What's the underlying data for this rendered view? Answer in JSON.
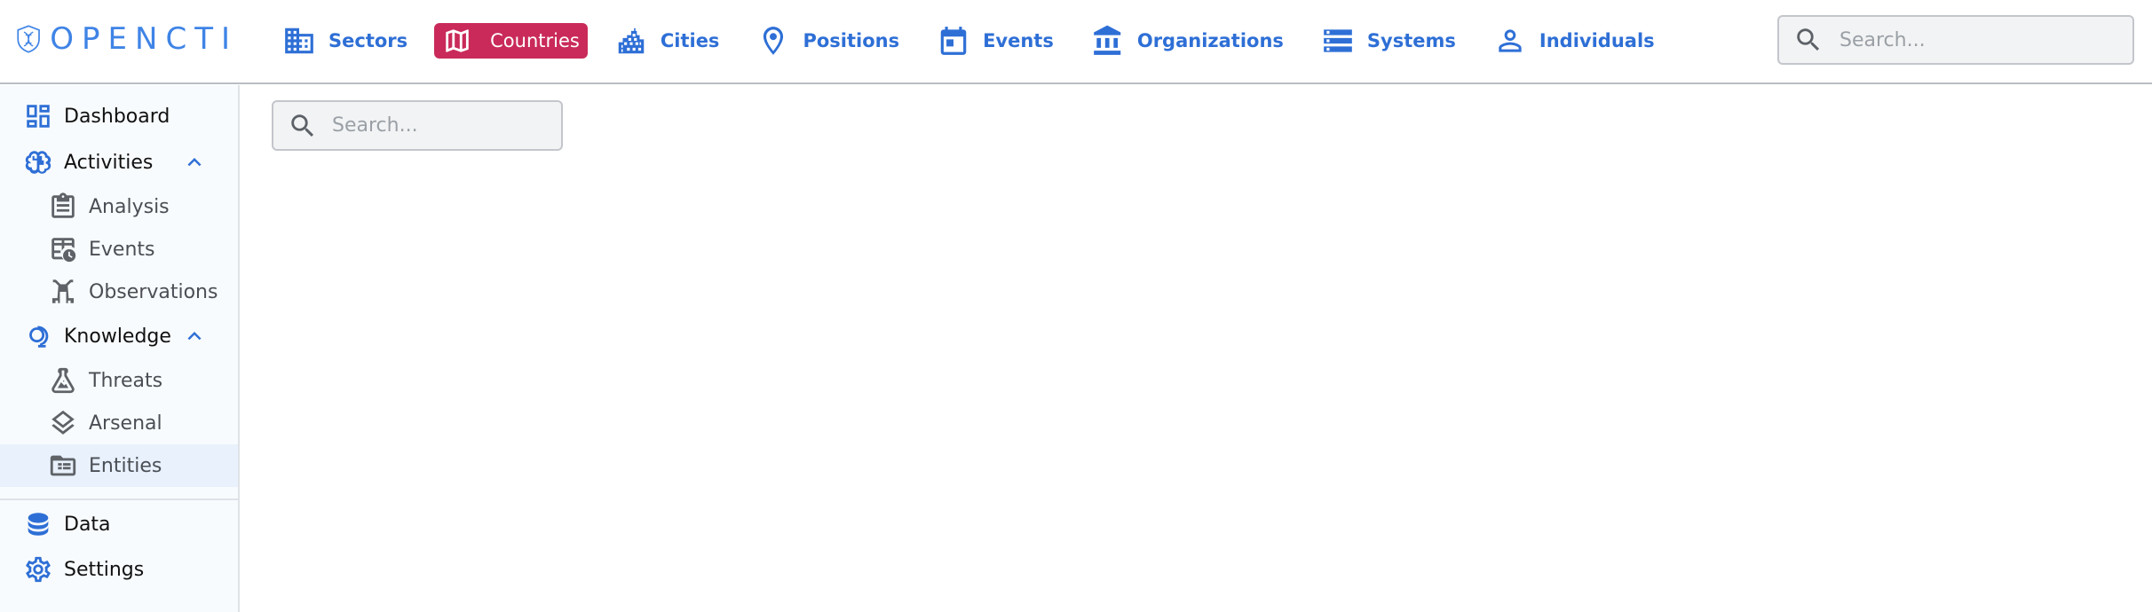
{
  "app": {
    "logo_text": "OPENCTI"
  },
  "topnav": {
    "items": [
      {
        "label": "Sectors",
        "icon": "domain-icon"
      },
      {
        "label": "Countries",
        "icon": "map-icon",
        "active": true
      },
      {
        "label": "Cities",
        "icon": "city-icon"
      },
      {
        "label": "Positions",
        "icon": "map-marker-icon"
      },
      {
        "label": "Events",
        "icon": "calendar-icon"
      },
      {
        "label": "Organizations",
        "icon": "bank-icon"
      },
      {
        "label": "Systems",
        "icon": "storage-icon"
      },
      {
        "label": "Individuals",
        "icon": "person-icon"
      }
    ],
    "search_placeholder": "Search..."
  },
  "sidebar": {
    "dashboard": "Dashboard",
    "activities": "Activities",
    "analysis": "Analysis",
    "events": "Events",
    "observations": "Observations",
    "knowledge": "Knowledge",
    "threats": "Threats",
    "arsenal": "Arsenal",
    "entities": "Entities",
    "data": "Data",
    "settings": "Settings"
  },
  "main": {
    "search_placeholder": "Search..."
  },
  "colors": {
    "accent": "#2e6fd6",
    "active_tab": "#c92a59",
    "selected_item_bg": "#e8f1fc"
  }
}
